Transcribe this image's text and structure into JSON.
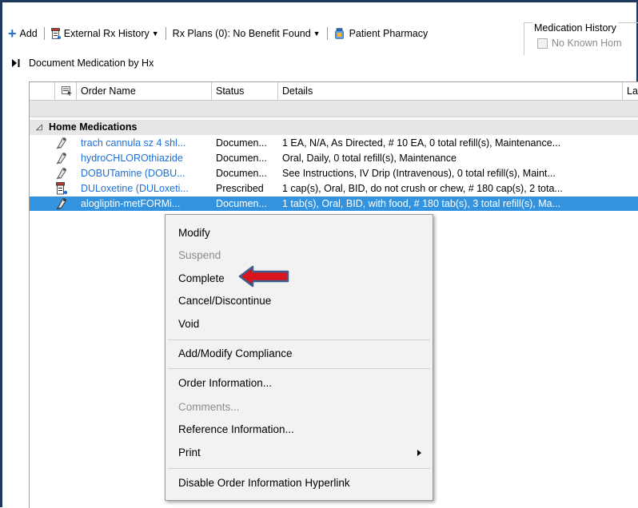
{
  "toolbar": {
    "add_label": "Add",
    "external_rx_label": "External Rx History",
    "rx_plans_label": "Rx Plans (0): No Benefit Found",
    "patient_pharmacy_label": "Patient Pharmacy"
  },
  "medication_history": {
    "title": "Medication History",
    "no_known_label": "No Known Hom"
  },
  "document_medication_label": "Document Medication by Hx",
  "grid": {
    "columns": [
      "Order Name",
      "Status",
      "Details",
      "Las"
    ],
    "group_label": "Home Medications",
    "rows": [
      {
        "name": "trach cannula sz 4 shl...",
        "status": "Documen...",
        "details": "1 EA, N/A, As Directed, # 10 EA, 0 total refill(s), Maintenance..."
      },
      {
        "name": "hydroCHLOROthiazide",
        "status": "Documen...",
        "details": "Oral, Daily, 0 total refill(s), Maintenance"
      },
      {
        "name": "DOBUTamine (DOBU...",
        "status": "Documen...",
        "details": "See Instructions, IV Drip (Intravenous), 0 total refill(s), Maint..."
      },
      {
        "name": "DULoxetine (DULoxeti...",
        "status": "Prescribed",
        "details": "1 cap(s), Oral, BID, do not crush or chew, # 180 cap(s), 2 tota..."
      },
      {
        "name": "alogliptin-metFORMi...",
        "status": "Documen...",
        "details": "1 tab(s), Oral, BID, with food, # 180 tab(s), 3 total refill(s), Ma..."
      }
    ]
  },
  "context_menu": {
    "modify": "Modify",
    "suspend": "Suspend",
    "complete": "Complete",
    "cancel_discontinue": "Cancel/Discontinue",
    "void": "Void",
    "add_modify_compliance": "Add/Modify Compliance",
    "order_information": "Order Information...",
    "comments": "Comments...",
    "reference_information": "Reference Information...",
    "print": "Print",
    "disable_hyperlink": "Disable Order Information Hyperlink"
  },
  "colors": {
    "selection": "#3393df",
    "link": "#1e6fd9",
    "arrow": "#d9141c",
    "arrow_outline": "#3b5f8f"
  }
}
